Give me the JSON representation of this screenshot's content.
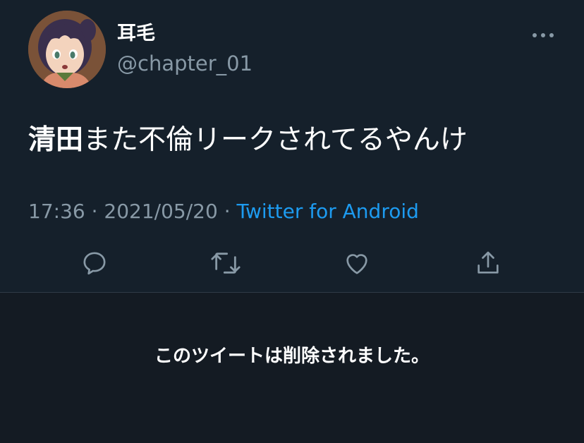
{
  "tweet": {
    "author": {
      "display_name": "耳毛",
      "handle": "@chapter_01",
      "avatar_icon": "anime-avatar"
    },
    "text_bold": "清田",
    "text_rest": "また不倫リークされてるやんけ",
    "time": "17:36",
    "separator1": " · ",
    "date": "2021/05/20",
    "separator2": " · ",
    "source": "Twitter for Android",
    "more_icon": "more-horizontal-icon"
  },
  "actions": [
    {
      "name": "reply",
      "icon": "reply-icon"
    },
    {
      "name": "retweet",
      "icon": "retweet-icon"
    },
    {
      "name": "like",
      "icon": "heart-icon"
    },
    {
      "name": "share",
      "icon": "share-icon"
    }
  ],
  "deleted_notice": "このツイートは削除されました。",
  "colors": {
    "background": "#15202b",
    "secondary_text": "#8899a6",
    "link": "#1d9bf0",
    "divider": "#2f3b47",
    "deleted_bg": "#141b23"
  }
}
